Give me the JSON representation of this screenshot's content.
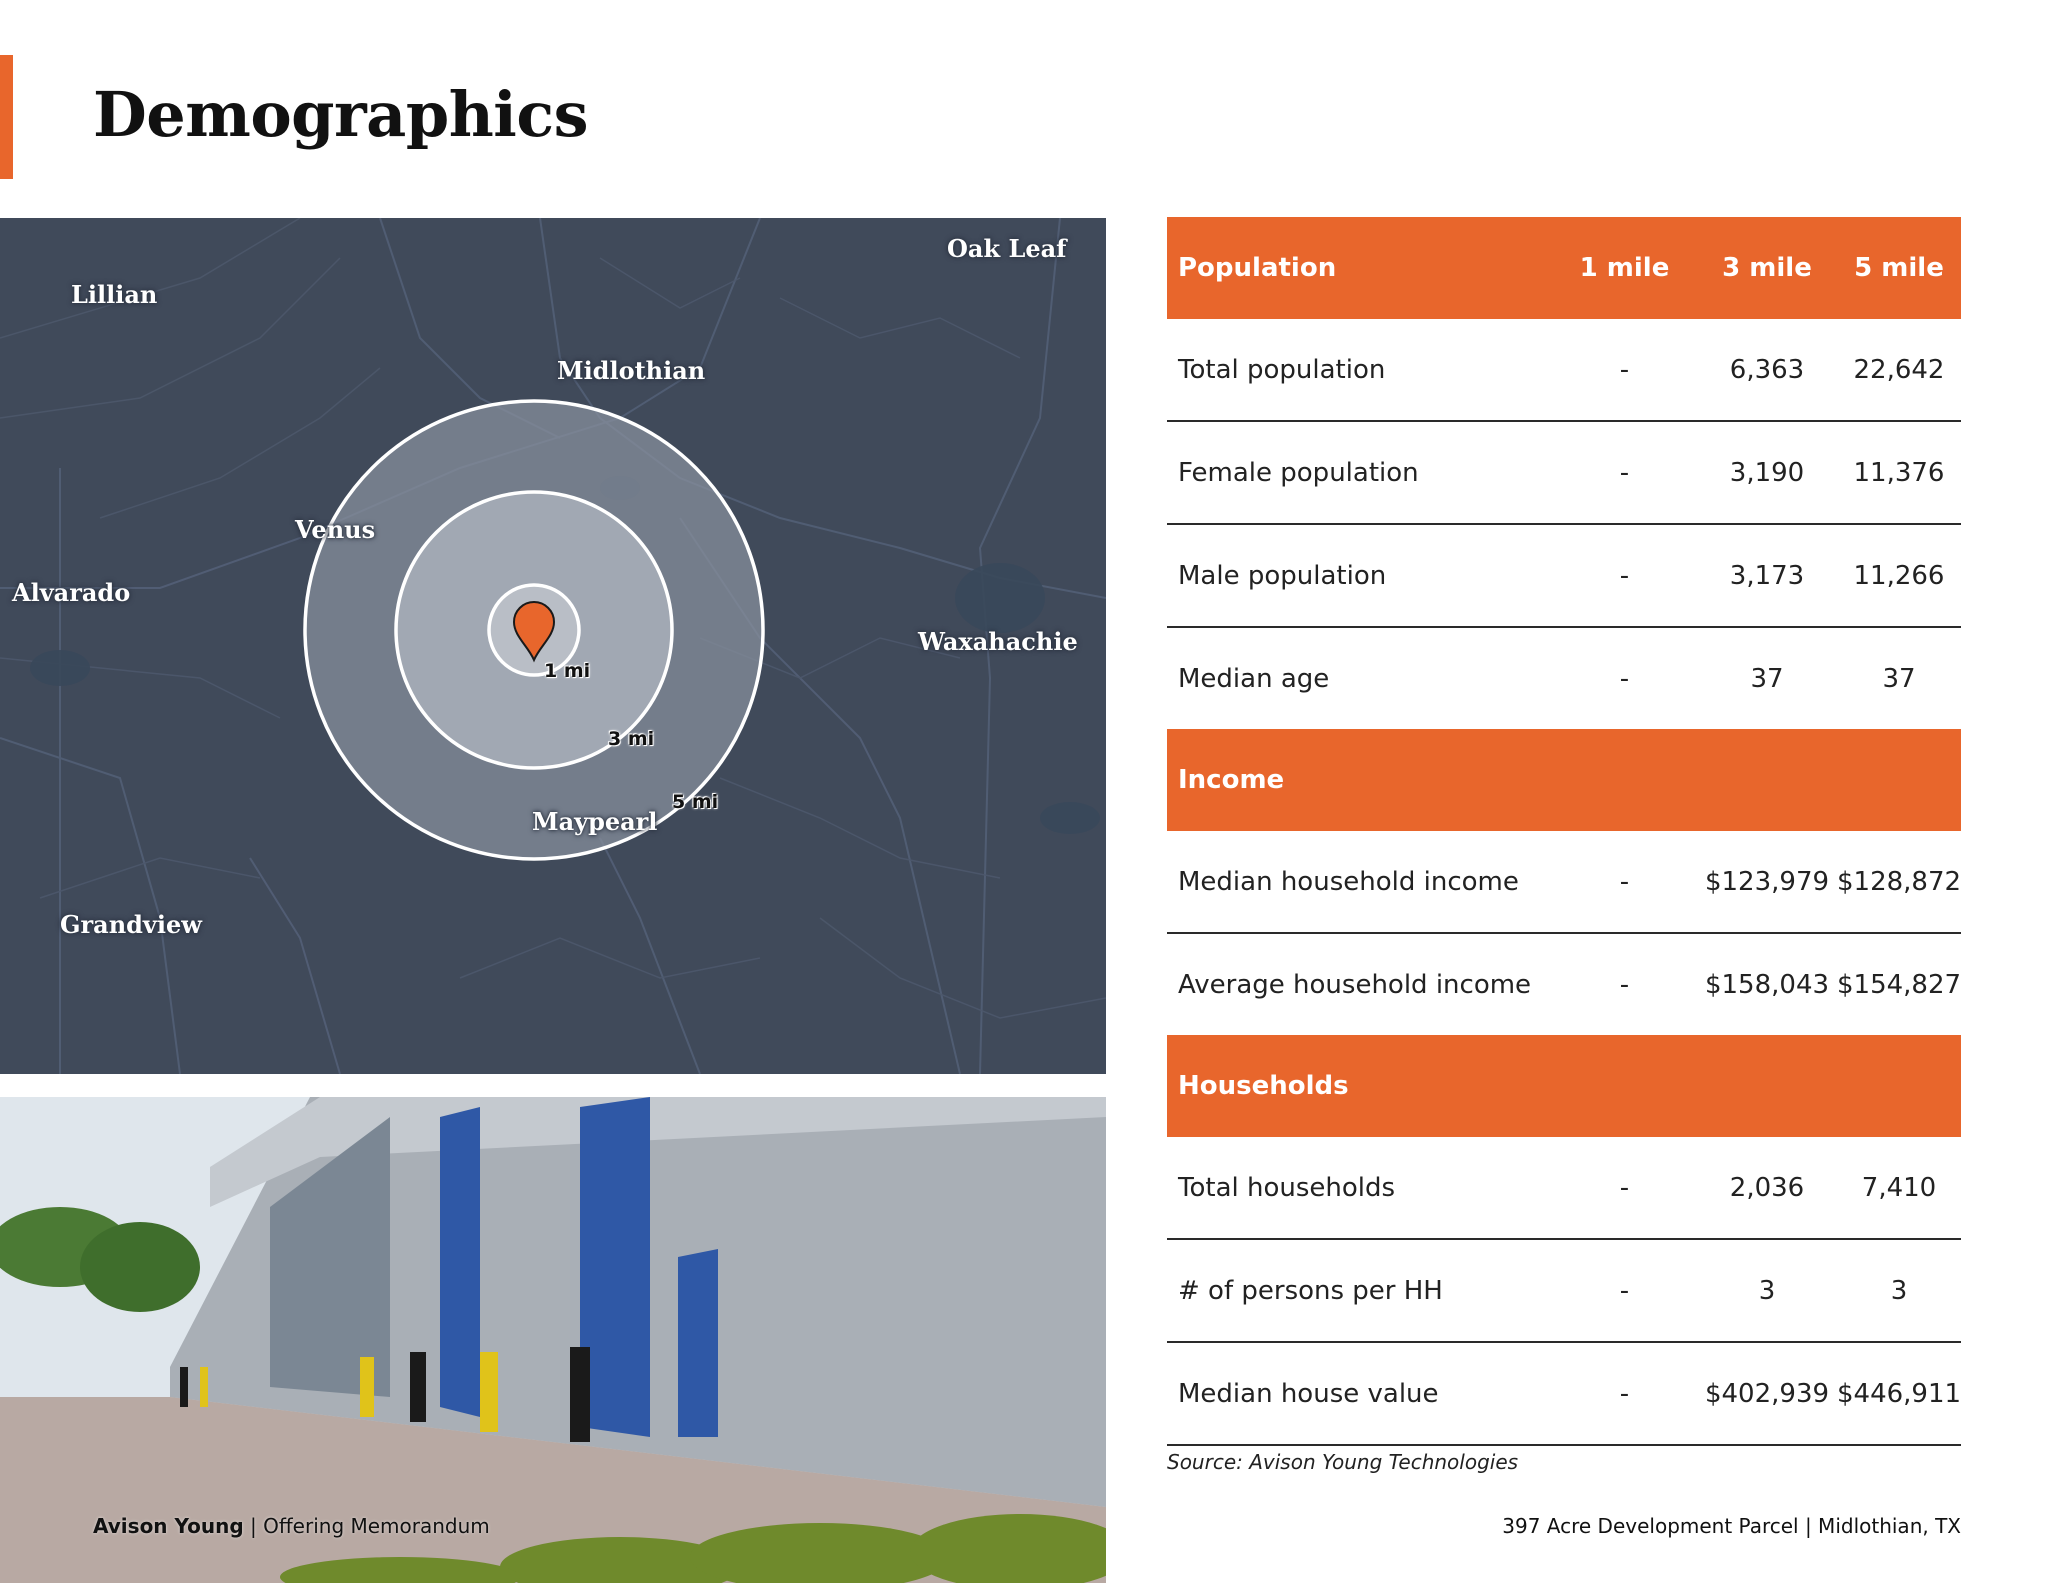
{
  "page": {
    "title": "Demographics"
  },
  "map": {
    "towns": [
      "Oak Leaf",
      "Lillian",
      "Midlothian",
      "Venus",
      "Alvarado",
      "Waxahachie",
      "Maypearl",
      "Grandview"
    ],
    "rings": [
      "1 mi",
      "3 mi",
      "5 mi"
    ],
    "pin_color": "#e8662c",
    "background_color": "#404a5a"
  },
  "table": {
    "columns": [
      "1 mile",
      "3 mile",
      "5 mile"
    ],
    "sections": [
      {
        "title": "Population",
        "rows": [
          {
            "label": "Total population",
            "values": [
              "-",
              "6,363",
              "22,642"
            ]
          },
          {
            "label": "Female population",
            "values": [
              "-",
              "3,190",
              "11,376"
            ]
          },
          {
            "label": "Male population",
            "values": [
              "-",
              "3,173",
              "11,266"
            ]
          },
          {
            "label": "Median age",
            "values": [
              "-",
              "37",
              "37"
            ]
          }
        ]
      },
      {
        "title": "Income",
        "rows": [
          {
            "label": "Median household income",
            "values": [
              "-",
              "$123,979",
              "$128,872"
            ]
          },
          {
            "label": "Average household income",
            "values": [
              "-",
              "$158,043",
              "$154,827"
            ]
          }
        ]
      },
      {
        "title": "Households",
        "rows": [
          {
            "label": "Total households",
            "values": [
              "-",
              "2,036",
              "7,410"
            ]
          },
          {
            "label": "# of persons per HH",
            "values": [
              "-",
              "3",
              "3"
            ]
          },
          {
            "label": "Median house value",
            "values": [
              "-",
              "$402,939",
              "$446,911"
            ]
          }
        ]
      }
    ],
    "source": "Source: Avison Young Technologies"
  },
  "footer": {
    "brand": "Avison Young",
    "separator": "|",
    "doc_type": "Offering Memorandum",
    "property": "397 Acre Development Parcel | Midlothian, TX"
  },
  "colors": {
    "accent": "#e8662c"
  }
}
